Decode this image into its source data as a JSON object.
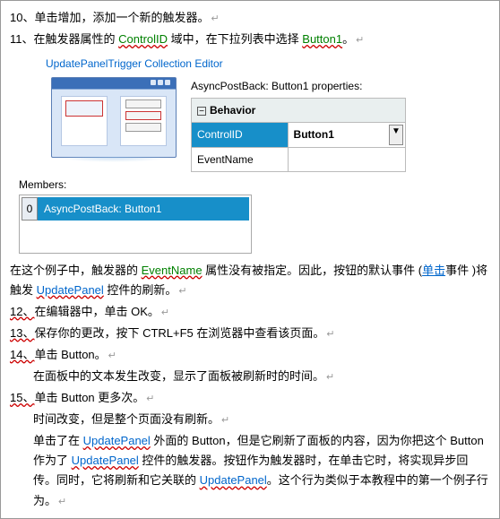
{
  "steps": {
    "s10": {
      "num": "10、",
      "text": "单击增加，添加一个新的触发器。",
      "ret": "↵"
    },
    "s11": {
      "num": "11、",
      "p1": "在触发器属性的 ",
      "control_id": "ControlID",
      "p2": " 域中，在下拉列表中选择 ",
      "button1": "Button1",
      "p3": "。",
      "ret": "↵"
    },
    "s12": {
      "num": "12、",
      "text": "在编辑器中，单击 OK。",
      "ret": "↵"
    },
    "s13": {
      "num": "13、",
      "text": "保存你的更改，按下 CTRL+F5 在浏览器中查看该页面。",
      "ret": "↵"
    },
    "s14": {
      "num": "14、",
      "text": "单击 Button。",
      "ret": "↵"
    },
    "s14b": {
      "text": "在面板中的文本发生改变，显示了面板被刷新时的时间。",
      "ret": "↵"
    },
    "s15": {
      "num": "15、",
      "text": "单击 Button 更多次。",
      "ret": "↵"
    },
    "s15b": {
      "text": "时间改变，但是整个页面没有刷新。",
      "ret": "↵"
    }
  },
  "editor": {
    "title": "UpdatePanelTrigger Collection Editor",
    "props_title": "AsyncPostBack: Button1 properties:",
    "behavior": "Behavior",
    "control_id_lbl": "ControlID",
    "control_id_val": "Button1",
    "event_name_lbl": "EventName",
    "members_lbl": "Members:",
    "member_index": "0",
    "member_text": "AsyncPostBack: Button1"
  },
  "mid": {
    "p1a": "在这个例子中，触发器的 ",
    "event_name": "EventName",
    "p1b": " 属性没有被指定。因此，按钮的默认事件 (",
    "click": "单击",
    "p1c": "事件 )将触发 ",
    "update_panel": "UpdatePanel",
    "p1d": " 控件的刷新。",
    "ret": "↵"
  },
  "end": {
    "l1a": "单击了在 ",
    "up": "UpdatePanel",
    "l1b": " 外面的 Button，但是它刷新了面板的内容，因为你把这个 Button 作为了 ",
    "l2a": " 控件的触发器。按钮作为触发器时，在单击它时，将实现异步回传。同时，它将刷新和它关联的 ",
    "l3a": "。这个行为类似于本教程中的第一个例子行为。",
    "ret": "↵"
  }
}
